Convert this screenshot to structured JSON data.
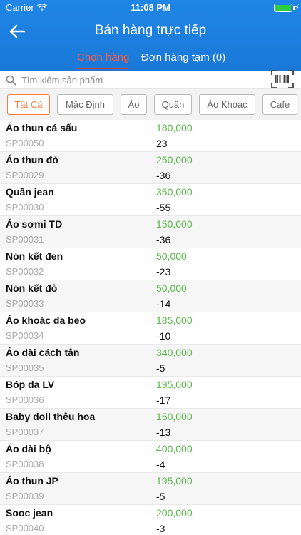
{
  "status": {
    "carrier": "Carrier",
    "time": "11:08 PM"
  },
  "header": {
    "title": "Bán hàng trực tiếp"
  },
  "tabs": [
    {
      "label": "Chọn hàng",
      "active": true
    },
    {
      "label": "Đơn hàng tạm (0)",
      "active": false
    }
  ],
  "search": {
    "placeholder": "Tìm kiếm sản phẩm"
  },
  "filters": [
    {
      "label": "Tất Cả",
      "active": true
    },
    {
      "label": "Mặc Định"
    },
    {
      "label": "Áo"
    },
    {
      "label": "Quần"
    },
    {
      "label": "Áo Khoác"
    },
    {
      "label": "Cafe"
    }
  ],
  "products": [
    {
      "name": "Áo thun cá sấu",
      "code": "SP00050",
      "price": "180,000",
      "stock": "23"
    },
    {
      "name": "Áo thun đỏ",
      "code": "SP00029",
      "price": "250,000",
      "stock": "-36"
    },
    {
      "name": "Quần jean",
      "code": "SP00030",
      "price": "350,000",
      "stock": "-55"
    },
    {
      "name": "Áo sơmi TD",
      "code": "SP00031",
      "price": "150,000",
      "stock": "-36"
    },
    {
      "name": "Nón kết đen",
      "code": "SP00032",
      "price": "50,000",
      "stock": "-23"
    },
    {
      "name": "Nón kết đỏ",
      "code": "SP00033",
      "price": "50,000",
      "stock": "-14"
    },
    {
      "name": "Áo khoác da beo",
      "code": "SP00034",
      "price": "185,000",
      "stock": "-10"
    },
    {
      "name": "Áo dài cách tân",
      "code": "SP00035",
      "price": "340,000",
      "stock": "-5"
    },
    {
      "name": "Bóp da LV",
      "code": "SP00036",
      "price": "195,000",
      "stock": "-17"
    },
    {
      "name": "Baby doll thêu hoa",
      "code": "SP00037",
      "price": "150,000",
      "stock": "-13"
    },
    {
      "name": "Áo dài bộ",
      "code": "SP00038",
      "price": "400,000",
      "stock": "-4"
    },
    {
      "name": "Áo thun JP",
      "code": "SP00039",
      "price": "195,000",
      "stock": "-5"
    },
    {
      "name": "Sooc jean",
      "code": "SP00040",
      "price": "200,000",
      "stock": "-3"
    }
  ],
  "colors": {
    "header": "#1f86e6",
    "active_tab": "#ff5a3d",
    "price": "#58b948",
    "chip_active": "#ff7a3d"
  }
}
